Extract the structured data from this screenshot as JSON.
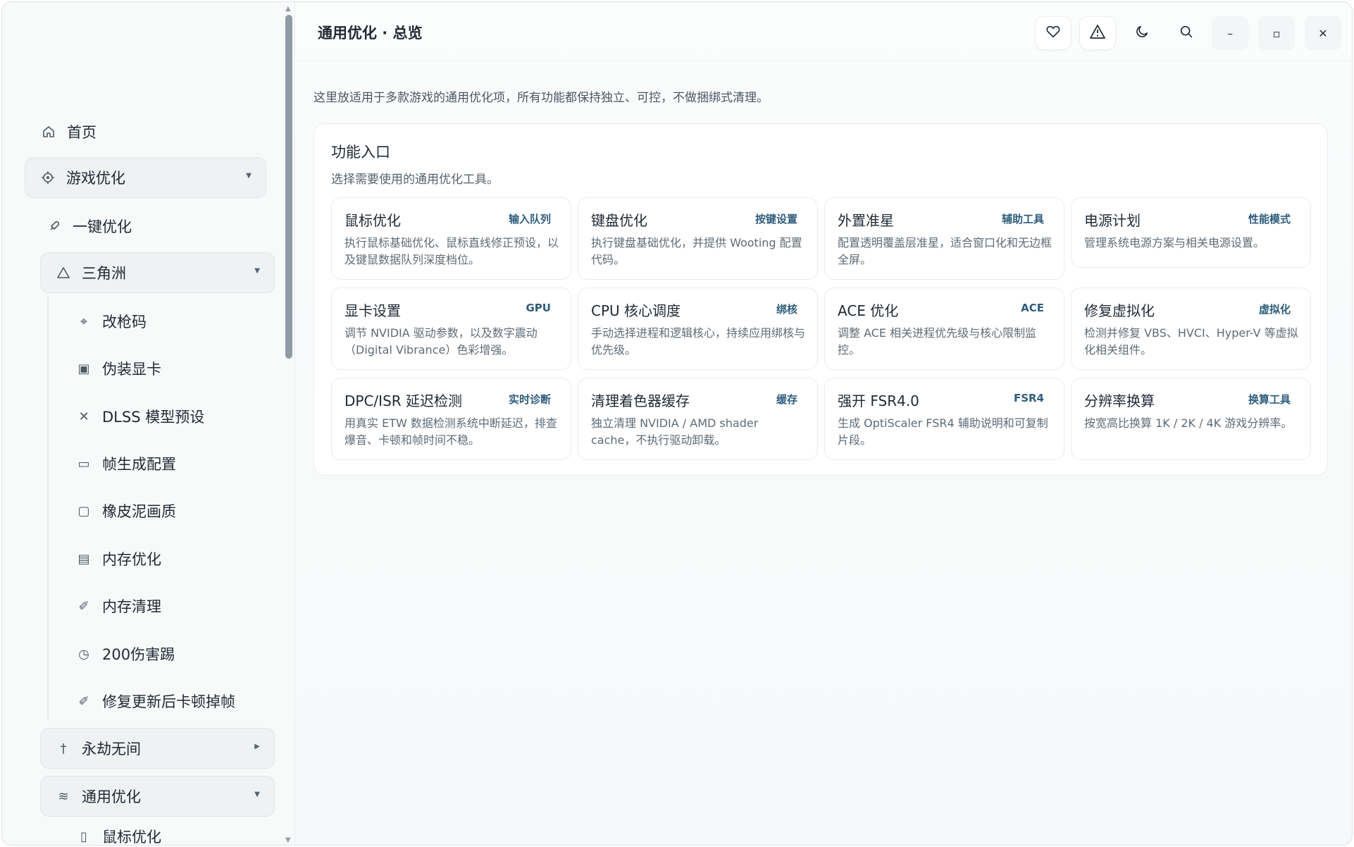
{
  "sidebar": {
    "home": "首页",
    "game_opt": "游戏优化",
    "one_click": "一键优化",
    "delta": "三角洲",
    "delta_items": [
      "改枪码",
      "伪装显卡",
      "DLSS 模型预设",
      "帧生成配置",
      "橡皮泥画质",
      "内存优化",
      "内存清理",
      "200伤害踢",
      "修复更新后卡顿掉帧"
    ],
    "eternal": "永劫无间",
    "general": "通用优化",
    "general_first": "鼠标优化"
  },
  "header": {
    "title": "通用优化 · 总览"
  },
  "main": {
    "intro": "这里放适用于多款游戏的通用优化项，所有功能都保持独立、可控，不做捆绑式清理。",
    "panel_title": "功能入口",
    "panel_sub": "选择需要使用的通用优化工具。",
    "cards": [
      {
        "title": "鼠标优化",
        "tag": "输入队列",
        "desc": "执行鼠标基础优化、鼠标直线修正预设，以及键鼠数据队列深度档位。"
      },
      {
        "title": "键盘优化",
        "tag": "按键设置",
        "desc": "执行键盘基础优化，并提供 Wooting 配置代码。"
      },
      {
        "title": "外置准星",
        "tag": "辅助工具",
        "desc": "配置透明覆盖层准星，适合窗口化和无边框全屏。"
      },
      {
        "title": "电源计划",
        "tag": "性能模式",
        "desc": "管理系统电源方案与相关电源设置。"
      },
      {
        "title": "显卡设置",
        "tag": "GPU",
        "desc": "调节 NVIDIA 驱动参数，以及数字震动（Digital Vibrance）色彩增强。"
      },
      {
        "title": "CPU 核心调度",
        "tag": "绑核",
        "desc": "手动选择进程和逻辑核心，持续应用绑核与优先级。"
      },
      {
        "title": "ACE 优化",
        "tag": "ACE",
        "desc": "调整 ACE 相关进程优先级与核心限制监控。"
      },
      {
        "title": "修复虚拟化",
        "tag": "虚拟化",
        "desc": "检测并修复 VBS、HVCI、Hyper-V 等虚拟化相关组件。"
      },
      {
        "title": "DPC/ISR 延迟检测",
        "tag": "实时诊断",
        "desc": "用真实 ETW 数据检测系统中断延迟，排查爆音、卡顿和帧时间不稳。"
      },
      {
        "title": "清理着色器缓存",
        "tag": "缓存",
        "desc": "独立清理 NVIDIA / AMD shader cache，不执行驱动卸载。"
      },
      {
        "title": "强开 FSR4.0",
        "tag": "FSR4",
        "desc": "生成 OptiScaler FSR4 辅助说明和可复制片段。"
      },
      {
        "title": "分辨率换算",
        "tag": "换算工具",
        "desc": "按宽高比换算 1K / 2K / 4K 游戏分辨率。"
      }
    ]
  }
}
